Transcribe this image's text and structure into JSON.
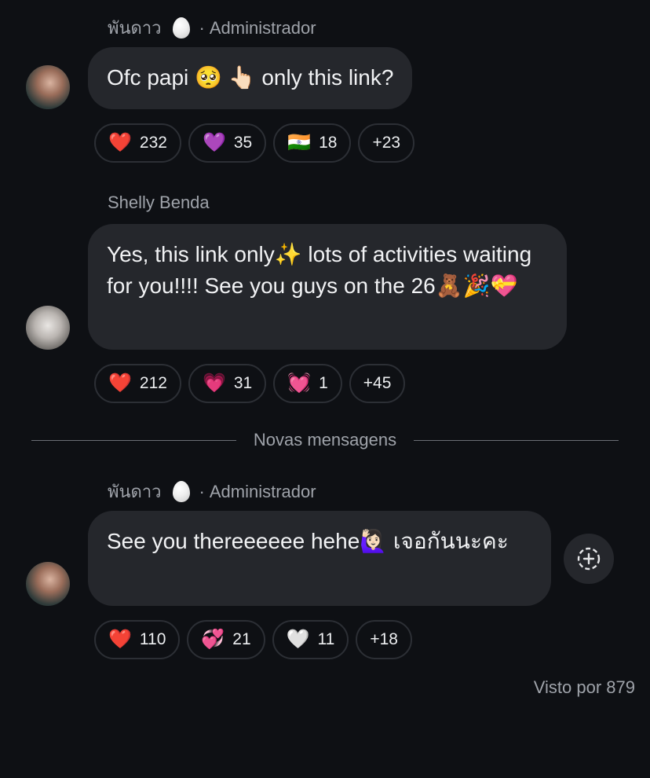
{
  "messages": [
    {
      "sender_name": "พันดาว",
      "sender_role": "Administrador",
      "text": "Ofc papi 🥺 👆🏻 only this link?",
      "reactions": [
        {
          "emoji": "❤️",
          "count": "232"
        },
        {
          "emoji": "💜",
          "count": "35"
        },
        {
          "emoji": "🇮🇳",
          "count": "18"
        }
      ],
      "more": "+23"
    },
    {
      "sender_name": "Shelly Benda",
      "text": "Yes, this link only✨  lots of activities waiting for you!!!! See you guys on the 26🧸🎉💝",
      "reactions": [
        {
          "emoji": "❤️",
          "count": "212"
        },
        {
          "emoji": "💗",
          "count": "31"
        },
        {
          "emoji": "💓",
          "count": "1"
        }
      ],
      "more": "+45"
    },
    {
      "sender_name": "พันดาว",
      "sender_role": "Administrador",
      "text": "See you thereeeeee hehe🙋🏻‍♀️ เจอกันนะคะ",
      "reactions": [
        {
          "emoji": "❤️",
          "count": "110"
        },
        {
          "emoji": "💞",
          "count": "21"
        },
        {
          "emoji": "🤍",
          "count": "11"
        }
      ],
      "more": "+18"
    }
  ],
  "divider_label": "Novas mensagens",
  "role_separator": "·",
  "seen_by": "Visto por 879",
  "icons": {
    "sender_badge": "egg-icon",
    "add_reaction": "add-reaction-icon"
  },
  "colors": {
    "background": "#0e1014",
    "bubble": "#25272c",
    "muted_text": "#9fa3aa",
    "pill_border": "#2c2f35"
  }
}
